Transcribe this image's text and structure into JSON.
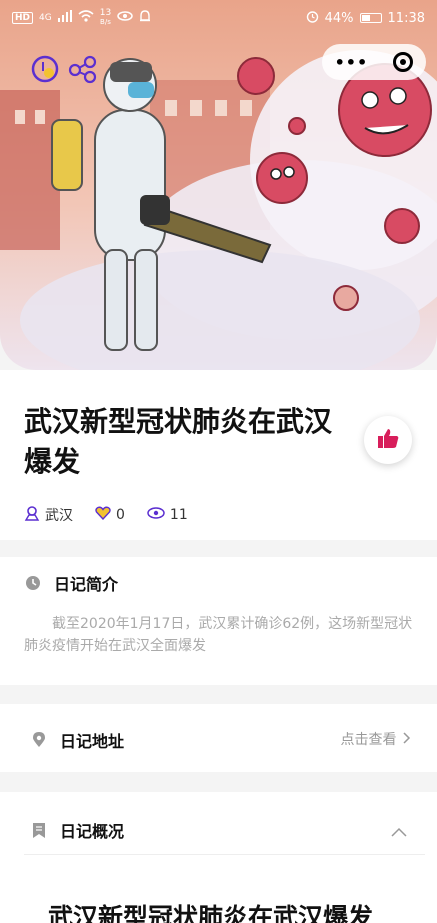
{
  "status_bar": {
    "hd": "HD",
    "network": "4G",
    "speed_value": "13",
    "speed_unit": "B/s",
    "battery_pct": "44%",
    "time": "11:38"
  },
  "capsule": {
    "more_label": "•••"
  },
  "diary": {
    "title": "武汉新型冠状肺炎在武汉爆发",
    "location": "武汉",
    "likes": "0",
    "views": "11"
  },
  "intro": {
    "heading": "日记简介",
    "text": "截至2020年1月17日，武汉累计确诊62例，这场新型冠状肺炎疫情开始在武汉全面爆发"
  },
  "address": {
    "heading": "日记地址",
    "action": "点击查看"
  },
  "overview": {
    "heading": "日记概况",
    "content_title": "武汉新型冠状肺炎在武汉爆发"
  },
  "colors": {
    "accent": "#d81e5b",
    "muted": "#999999"
  }
}
